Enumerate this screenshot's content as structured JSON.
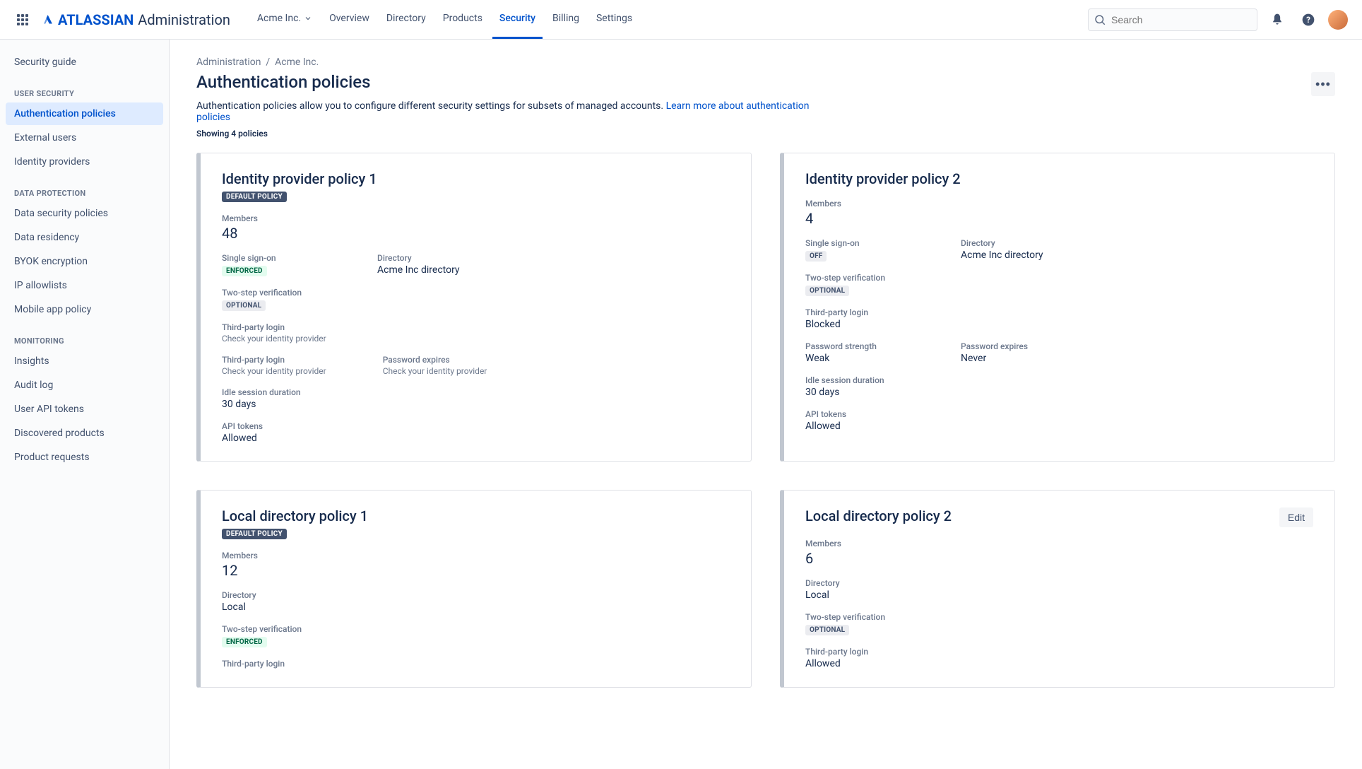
{
  "brand": {
    "name": "ATLASSIAN",
    "suffix": "Administration"
  },
  "topnav": {
    "org": "Acme Inc.",
    "items": [
      "Overview",
      "Directory",
      "Products",
      "Security",
      "Billing",
      "Settings"
    ],
    "active": "Security"
  },
  "search": {
    "placeholder": "Search"
  },
  "sidebar": {
    "top": "Security guide",
    "groups": [
      {
        "header": "USER SECURITY",
        "items": [
          "Authentication policies",
          "External users",
          "Identity providers"
        ],
        "active": "Authentication policies"
      },
      {
        "header": "DATA PROTECTION",
        "items": [
          "Data security policies",
          "Data residency",
          "BYOK encryption",
          "IP allowlists",
          "Mobile app policy"
        ]
      },
      {
        "header": "MONITORING",
        "items": [
          "Insights",
          "Audit log",
          "User API tokens",
          "Discovered products",
          "Product requests"
        ]
      }
    ]
  },
  "breadcrumb": {
    "a": "Administration",
    "b": "Acme Inc."
  },
  "page": {
    "title": "Authentication policies",
    "desc_prefix": "Authentication policies allow you to configure different security settings for subsets of managed accounts. ",
    "desc_link": "Learn more about authentication policies",
    "showing": "Showing 4 policies"
  },
  "labels": {
    "members": "Members",
    "sso": "Single sign-on",
    "directory": "Directory",
    "twostep": "Two-step verification",
    "thirdparty": "Third-party login",
    "pw_strength": "Password strength",
    "pw_expires": "Password expires",
    "idle": "Idle session duration",
    "api": "API tokens",
    "check_idp": "Check your identity provider",
    "default": "DEFAULT POLICY",
    "edit": "Edit",
    "enforced": "ENFORCED",
    "optional": "OPTIONAL",
    "off": "OFF"
  },
  "cards": {
    "c1": {
      "title": "Identity provider policy 1",
      "default": true,
      "members": "48",
      "sso": "ENFORCED",
      "directory": "Acme Inc directory",
      "twostep": "OPTIONAL",
      "idle": "30 days",
      "api": "Allowed"
    },
    "c2": {
      "title": "Identity provider policy 2",
      "members": "4",
      "sso": "OFF",
      "directory": "Acme Inc directory",
      "twostep": "OPTIONAL",
      "thirdparty": "Blocked",
      "pw_strength": "Weak",
      "pw_expires": "Never",
      "idle": "30 days",
      "api": "Allowed"
    },
    "c3": {
      "title": "Local directory policy 1",
      "default": true,
      "members": "12",
      "directory": "Local",
      "twostep": "ENFORCED",
      "thirdparty_label": "Third-party login"
    },
    "c4": {
      "title": "Local directory policy 2",
      "members": "6",
      "directory": "Local",
      "twostep": "OPTIONAL",
      "thirdparty": "Allowed"
    }
  }
}
